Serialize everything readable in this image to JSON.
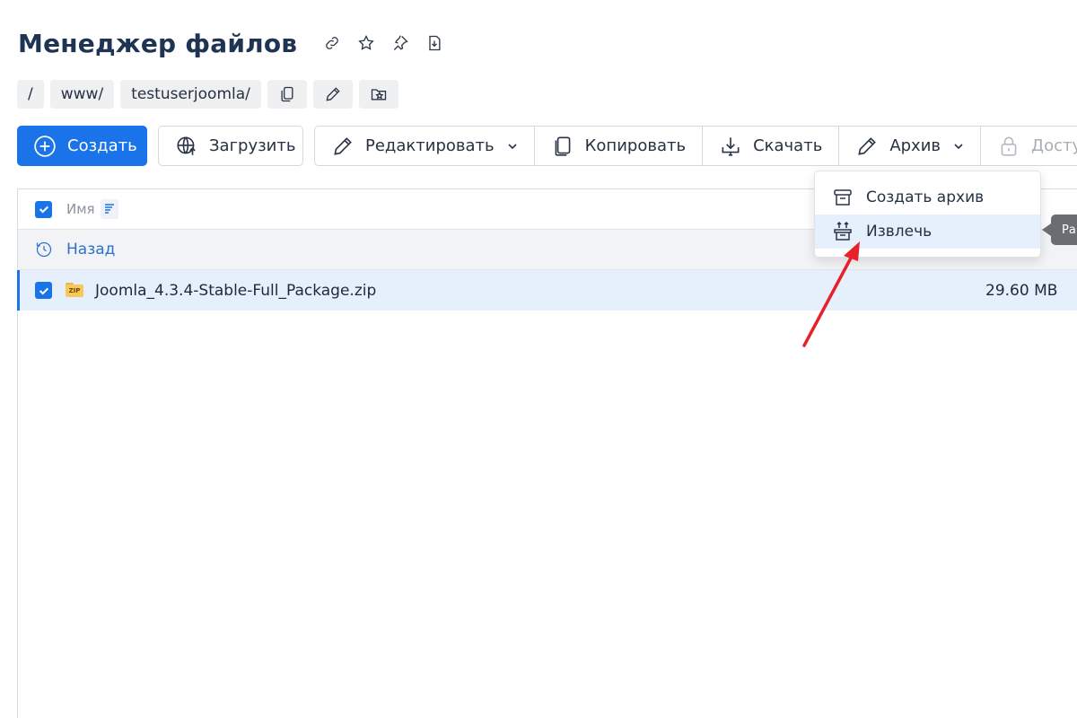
{
  "page": {
    "title": "Менеджер файлов",
    "title_icons": [
      "link-icon",
      "star-icon",
      "pin-icon",
      "download-file-icon"
    ]
  },
  "breadcrumbs": {
    "items": [
      "/",
      "www/",
      "testuserjoomla/"
    ],
    "actions": [
      "copy-path-icon",
      "edit-path-icon",
      "favorite-path-icon"
    ]
  },
  "toolbar": {
    "create_label": "Создать",
    "upload_label": "Загрузить",
    "edit_label": "Редактировать",
    "copy_label": "Копировать",
    "download_label": "Скачать",
    "archive_label": "Архив",
    "access_label": "Доступ"
  },
  "table": {
    "column_name": "Имя",
    "back_label": "Назад",
    "rows": [
      {
        "name": "Joomla_4.3.4-Stable-Full_Package.zip",
        "size": "29.60 MB",
        "selected": true,
        "icon_text": "ZIP"
      }
    ]
  },
  "archive_menu": {
    "items": [
      {
        "label": "Создать архив",
        "icon": "archive-box-icon",
        "active": false
      },
      {
        "label": "Извлечь",
        "icon": "extract-icon",
        "active": true
      }
    ]
  },
  "tooltip": {
    "text": "Ра"
  },
  "colors": {
    "accent": "#1a73e8",
    "link": "#2f6fd1",
    "annotation_arrow": "#e8202a"
  }
}
